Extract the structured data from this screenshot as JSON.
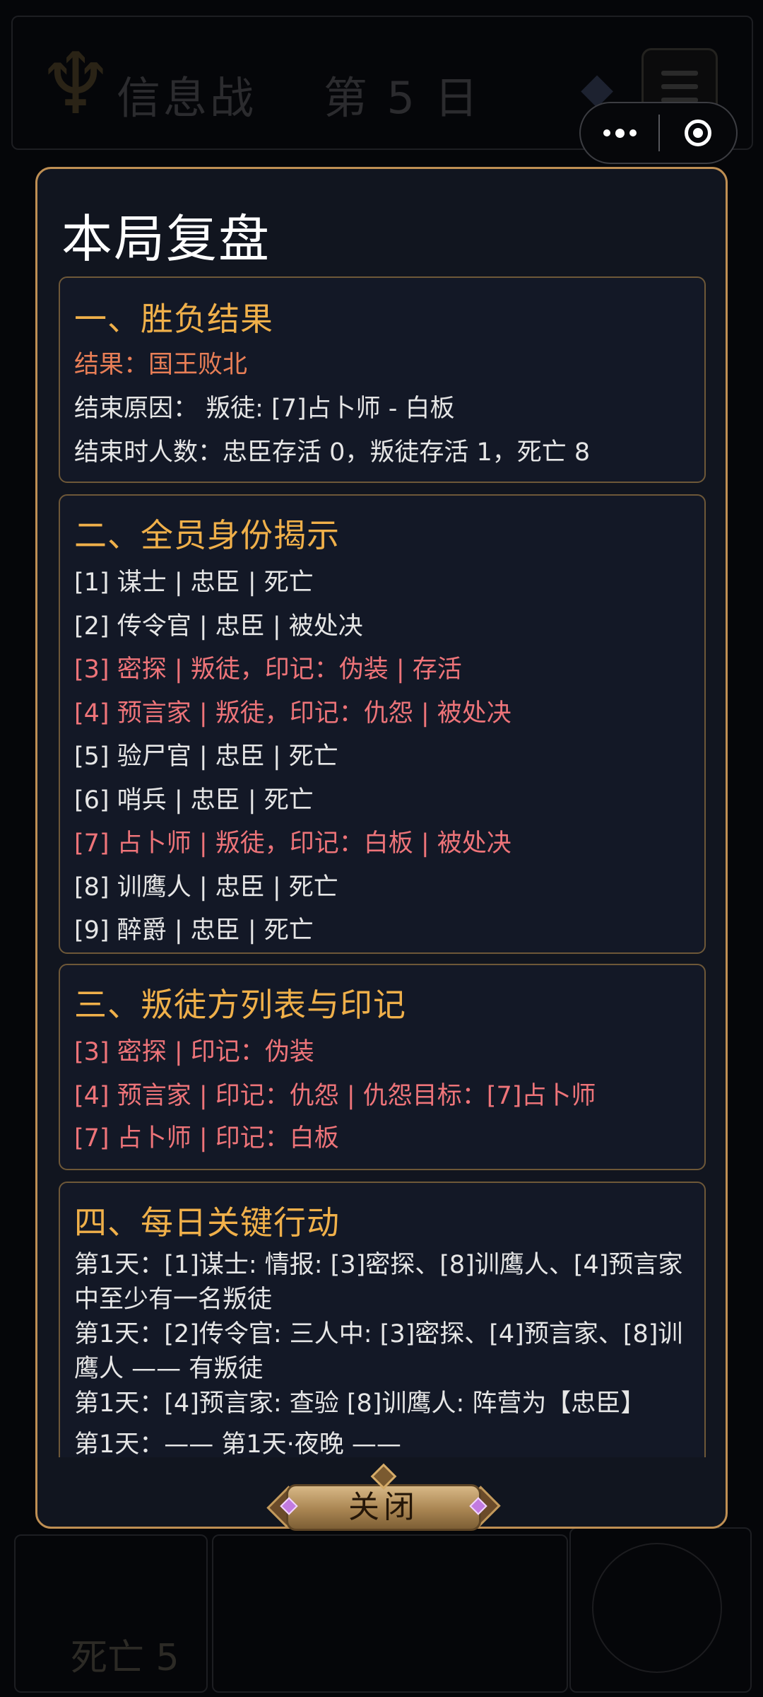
{
  "background": {
    "title": "信息战    第 5 日",
    "dead_label": "死亡 5",
    "menu_icon": "hamburger-icon",
    "emblem_icon": "trident-emblem-icon",
    "gem_icon": "crystal-icon"
  },
  "capsule": {
    "more_icon": "more-dots-icon",
    "close_icon": "target-close-icon"
  },
  "modal": {
    "title": "本局复盘",
    "close_label": "关闭",
    "colors": {
      "border": "#bf8f53",
      "heading": "#f0b04a",
      "traitor": "#ee7479",
      "result": "#e87e56"
    }
  },
  "sections": {
    "result": {
      "heading": "一、胜负结果",
      "outcome": "结果：国王败北",
      "reason": "结束原因：  叛徒: [7]占卜师 - 白板",
      "counts": "结束时人数：忠臣存活 0，叛徒存活 1，死亡 8"
    },
    "identities": {
      "heading": "二、全员身份揭示",
      "rows": [
        {
          "text": "[1] 谋士 | 忠臣 | 死亡",
          "traitor": false
        },
        {
          "text": "[2] 传令官 | 忠臣 | 被处决",
          "traitor": false
        },
        {
          "text": "[3] 密探 | 叛徒，印记：伪装 | 存活",
          "traitor": true
        },
        {
          "text": "[4] 预言家 | 叛徒，印记：仇怨 | 被处决",
          "traitor": true
        },
        {
          "text": "[5] 验尸官 | 忠臣 | 死亡",
          "traitor": false
        },
        {
          "text": "[6] 哨兵 | 忠臣 | 死亡",
          "traitor": false
        },
        {
          "text": "[7] 占卜师 | 叛徒，印记：白板 | 被处决",
          "traitor": true
        },
        {
          "text": "[8] 训鹰人 | 忠臣 | 死亡",
          "traitor": false
        },
        {
          "text": "[9] 醉爵 | 忠臣 | 死亡",
          "traitor": false
        }
      ]
    },
    "traitors": {
      "heading": "三、叛徒方列表与印记",
      "rows": [
        "[3] 密探 | 印记：伪装",
        "[4] 预言家 | 印记：仇怨 | 仇怨目标：[7]占卜师",
        "[7] 占卜师 | 印记：白板"
      ]
    },
    "actions": {
      "heading": "四、每日关键行动",
      "entries": [
        "第1天：[1]谋士: 情报: [3]密探、[8]训鹰人、[4]预言家 中至少有一名叛徒",
        "第1天：[2]传令官: 三人中: [3]密探、[4]预言家、[8]训鹰人 —— 有叛徒",
        "第1天：[4]预言家: 查验 [8]训鹰人: 阵营为【忠臣】",
        "第1天：—— 第1天·夜晚 ——"
      ]
    }
  }
}
